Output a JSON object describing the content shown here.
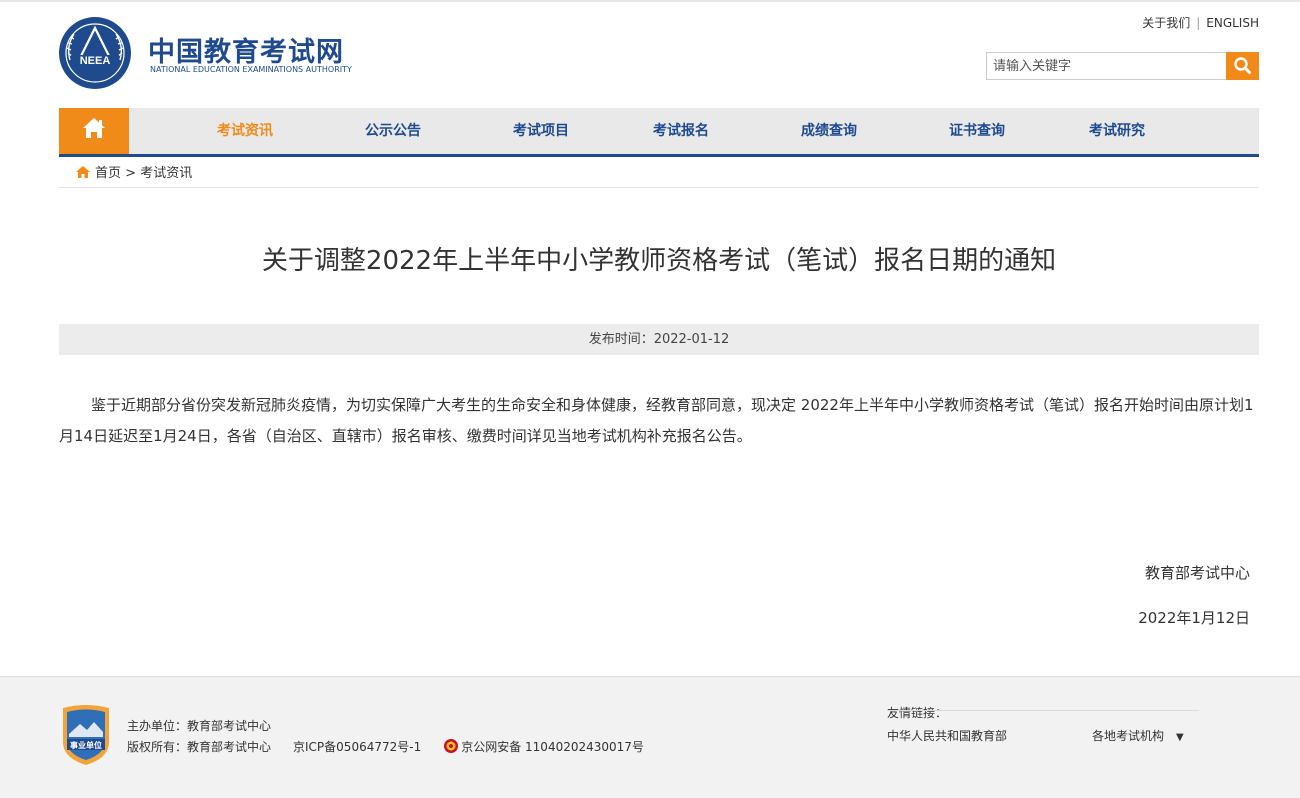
{
  "header": {
    "brand_cn": "中国教育考试网",
    "brand_en": "NATIONAL EDUCATION EXAMINATIONS AUTHORITY",
    "logo_text": "NEEA",
    "links": {
      "about": "关于我们",
      "separator": "|",
      "english": "ENGLISH"
    },
    "search": {
      "placeholder": "请输入关键字",
      "icon": "search-icon"
    }
  },
  "nav": {
    "home_icon": "home-icon",
    "items": [
      {
        "label": "考试资讯",
        "active": true
      },
      {
        "label": "公示公告"
      },
      {
        "label": "考试项目"
      },
      {
        "label": "考试报名"
      },
      {
        "label": "成绩查询"
      },
      {
        "label": "证书查询"
      },
      {
        "label": "考试研究"
      }
    ]
  },
  "breadcrumb": {
    "home": "首页",
    "sep": ">",
    "current": "考试资讯"
  },
  "article": {
    "title": "关于调整2022年上半年中小学教师资格考试（笔试）报名日期的通知",
    "publish": "发布时间：2022-01-12",
    "body": "鉴于近期部分省份突发新冠肺炎疫情，为切实保障广大考生的生命安全和身体健康，经教育部同意，现决定 2022年上半年中小学教师资格考试（笔试）报名开始时间由原计划1月14日延迟至1月24日，各省（自治区、直辖市）报名审核、缴费时间详见当地考试机构补充报名公告。",
    "signature": "教育部考试中心",
    "date": "2022年1月12日"
  },
  "footer": {
    "badge_text": "事业单位",
    "host": "主办单位：教育部考试中心",
    "copyright": "版权所有：教育部考试中心",
    "icp": "京ICP备05064772号-1",
    "police": "京公网安备 11040202430017号",
    "friend_title": "友情链接：",
    "friend_moe": "中华人民共和国教育部",
    "friend_select": "各地考试机构"
  },
  "colors": {
    "brand_blue": "#1f4b8e",
    "accent_orange": "#f08b1a"
  }
}
